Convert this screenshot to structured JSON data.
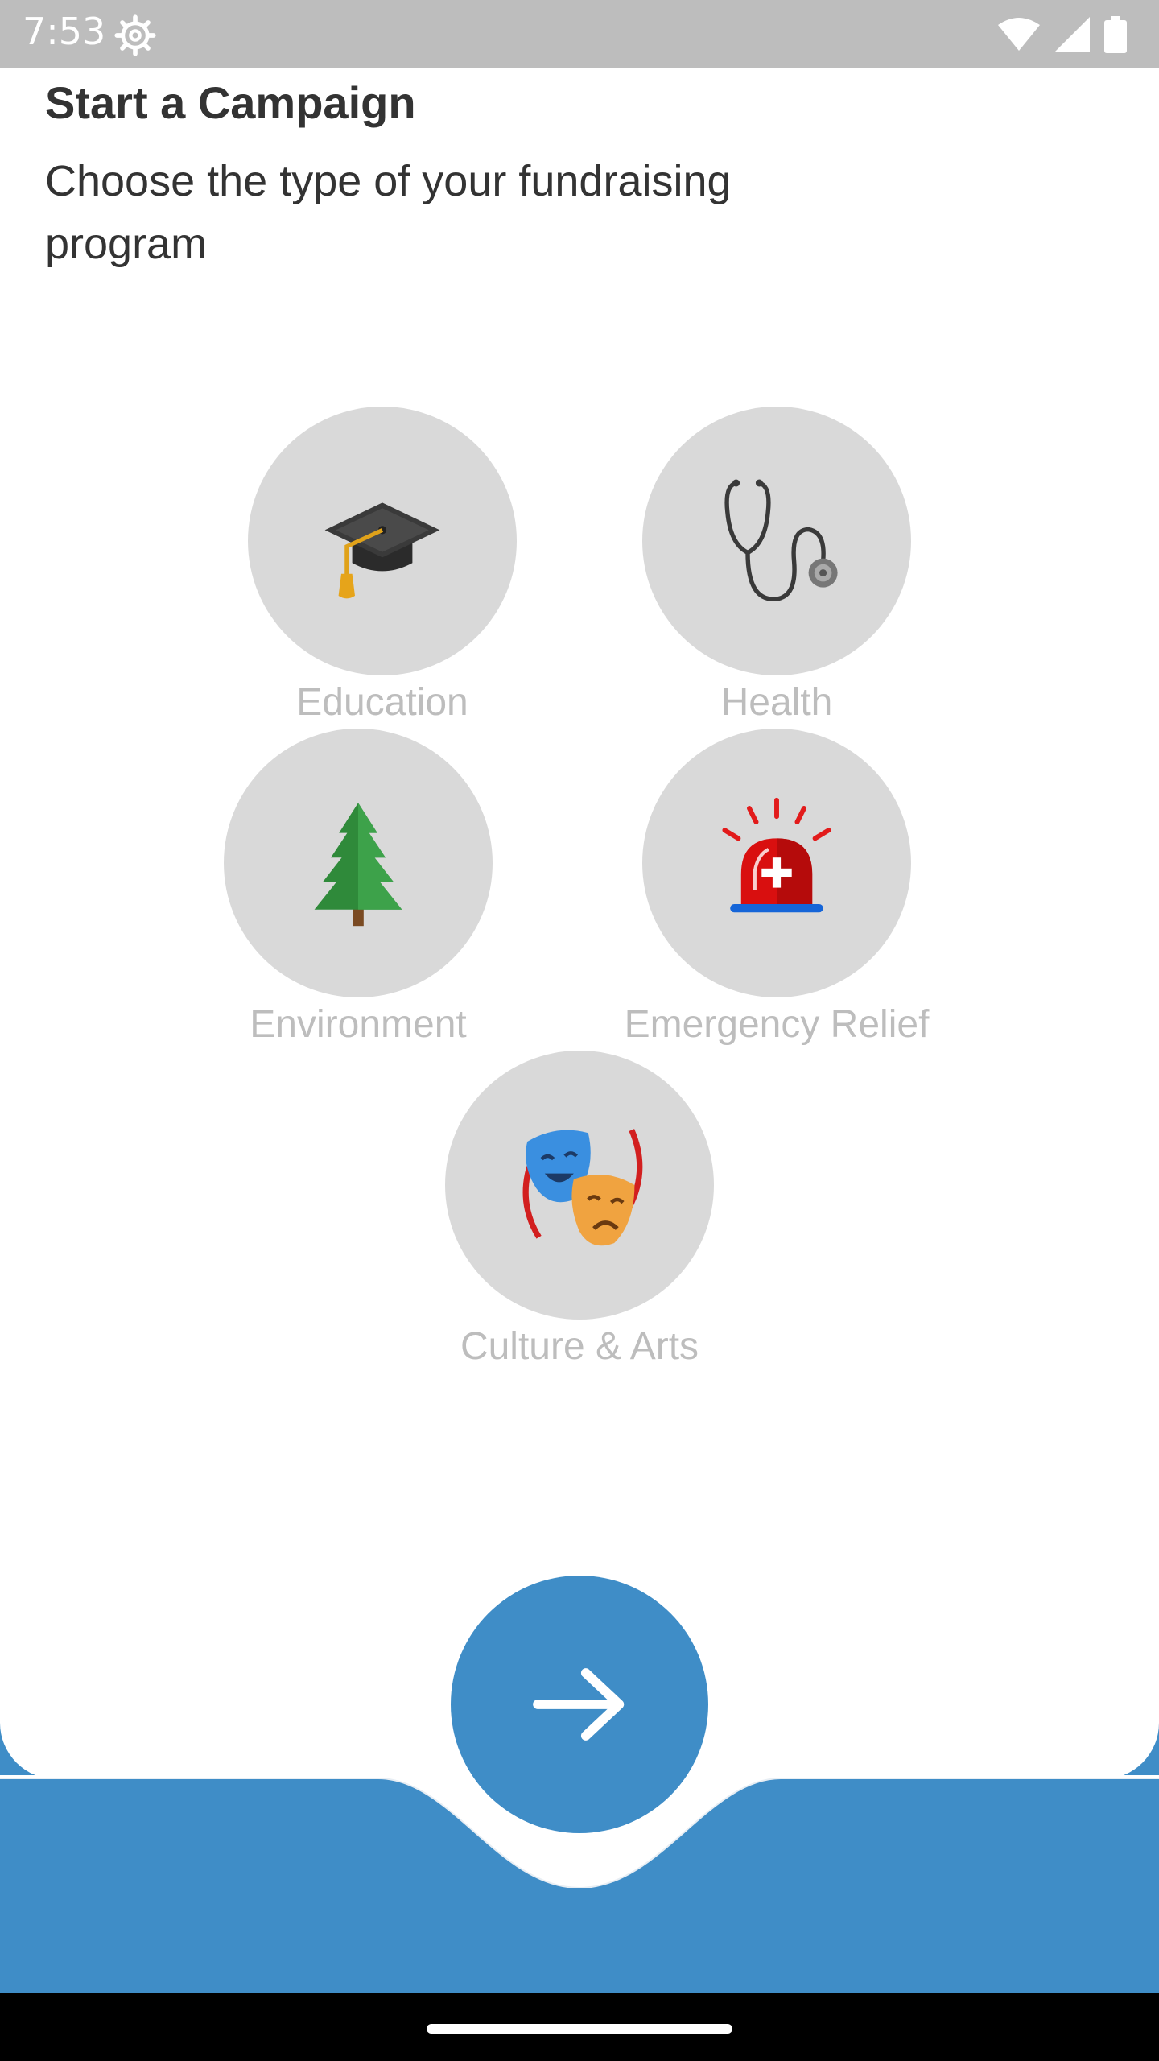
{
  "status_bar": {
    "time": "7:53",
    "icons": [
      "settings-gear-icon",
      "wifi-icon",
      "cell-signal-icon",
      "battery-icon"
    ]
  },
  "header": {
    "title": "Start a Campaign",
    "subtitle": "Choose the type of your fundraising program"
  },
  "categories": [
    {
      "label": "Education",
      "icon": "graduation-cap-icon"
    },
    {
      "label": "Health",
      "icon": "stethoscope-icon"
    },
    {
      "label": "Environment",
      "icon": "evergreen-tree-icon"
    },
    {
      "label": "Emergency Relief",
      "icon": "siren-icon"
    },
    {
      "label": "Culture & Arts",
      "icon": "theater-masks-icon"
    }
  ],
  "actions": {
    "next_icon": "arrow-right-icon"
  },
  "colors": {
    "accent": "#3f8dc7",
    "circle_bg": "#d9d9d9",
    "label_text": "#bdbdbd",
    "title_text": "#333333",
    "status_bar_bg": "#bdbdbd"
  }
}
